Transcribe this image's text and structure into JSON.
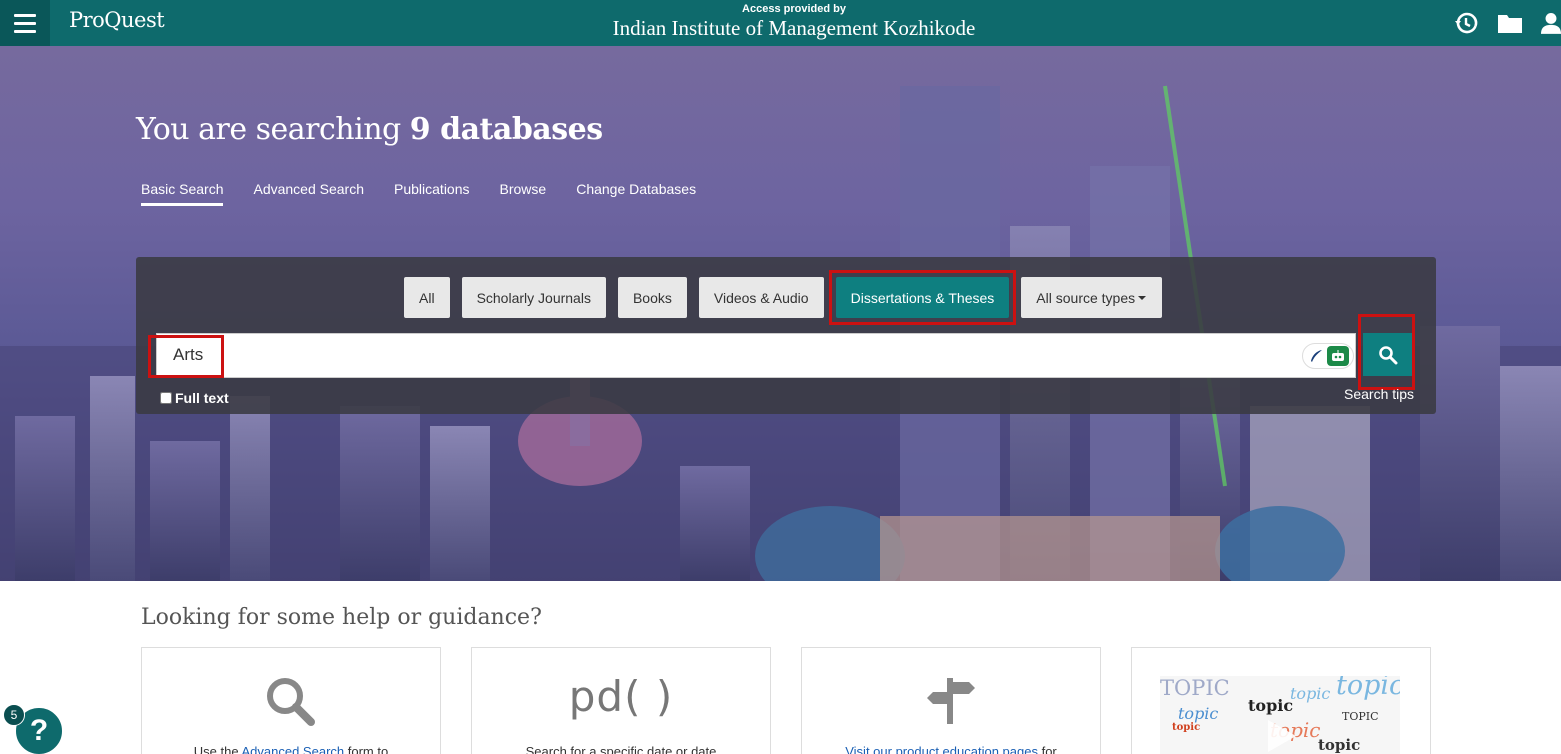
{
  "header": {
    "logo": "ProQuest",
    "access_label": "Access provided by",
    "institution": "Indian Institute of Management Kozhikode",
    "icons": [
      "menu-icon",
      "history-icon",
      "folder-icon",
      "user-icon"
    ]
  },
  "hero": {
    "title_prefix": "You are searching ",
    "title_bold": "9 databases",
    "tabs": [
      {
        "label": "Basic Search",
        "active": true
      },
      {
        "label": "Advanced Search",
        "active": false
      },
      {
        "label": "Publications",
        "active": false
      },
      {
        "label": "Browse",
        "active": false
      },
      {
        "label": "Change Databases",
        "active": false
      }
    ]
  },
  "search": {
    "filters": [
      {
        "label": "All",
        "selected": false
      },
      {
        "label": "Scholarly Journals",
        "selected": false
      },
      {
        "label": "Books",
        "selected": false
      },
      {
        "label": "Videos & Audio",
        "selected": false
      },
      {
        "label": "Dissertations & Theses",
        "selected": true
      },
      {
        "label": "All source types",
        "selected": false
      }
    ],
    "query": "Arts",
    "full_text_label": "Full text",
    "full_text_checked": false,
    "search_tips": "Search tips",
    "icons": [
      "search-icon",
      "feather-icon",
      "bot-icon",
      "caret-down-icon"
    ]
  },
  "help": {
    "title": "Looking for some help or guidance?",
    "cards": [
      {
        "icon": "magnifier-icon",
        "text_before": "Use the ",
        "link": "Advanced Search",
        "text_after": " form to"
      },
      {
        "icon": "pd-text",
        "icon_text": "pd( )",
        "text_before": "Search for a specific date or date",
        "link": "",
        "text_after": ""
      },
      {
        "icon": "signpost-icon",
        "text_before": "",
        "link": "Visit our product education pages",
        "text_after": " for"
      },
      {
        "icon": "topic-cloud-image",
        "text_before": "",
        "link": "",
        "text_after": ""
      }
    ],
    "topic_words": [
      "TOPIC",
      "topic",
      "topic",
      "topic",
      "topic",
      "TOPIC",
      "topic",
      "topic",
      "topic"
    ]
  },
  "fab": {
    "badge": "5",
    "label": "?"
  },
  "colors": {
    "header": "#0e6a6c",
    "accent": "#0e7f80",
    "highlight": "#cc1111"
  }
}
